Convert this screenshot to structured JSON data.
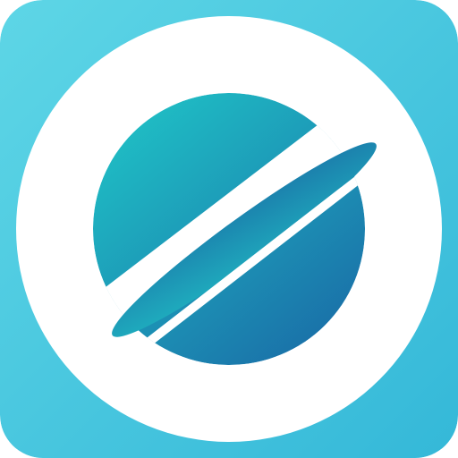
{
  "app_icon": {
    "name": "planet-app-icon",
    "icon": "planet-ring-icon",
    "colors": {
      "background_start": "#5ed6e6",
      "background_end": "#34b8d8",
      "circle": "#ffffff",
      "planet_light": "#1fbcc4",
      "planet_dark": "#1a6fa8",
      "ring_light": "#1fb2c0",
      "ring_dark": "#1b79aa"
    }
  }
}
